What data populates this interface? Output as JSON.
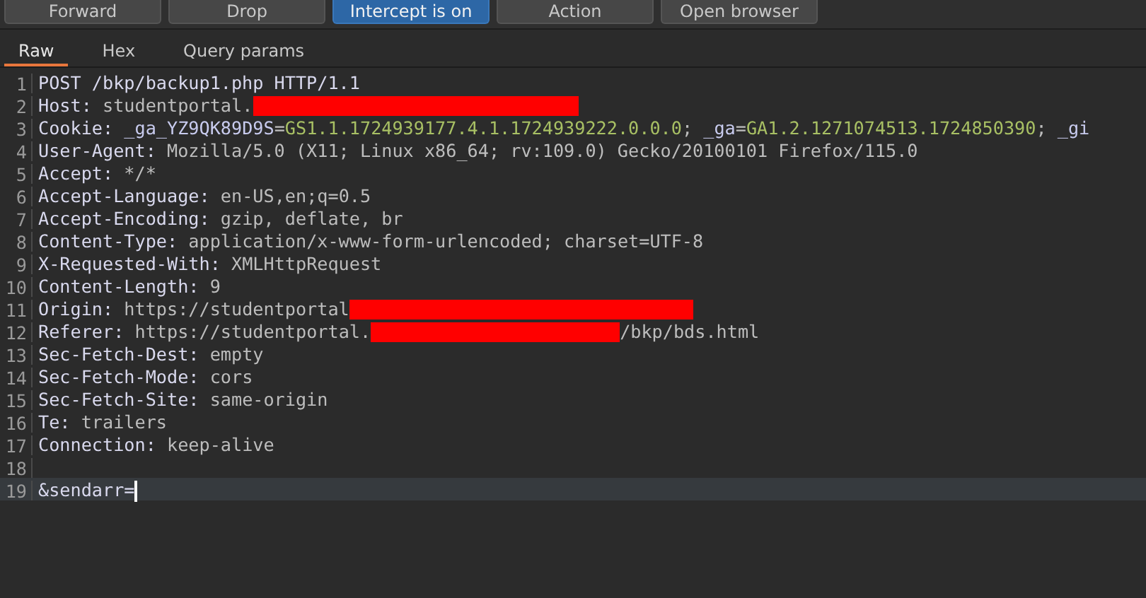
{
  "toolbar": {
    "buttons": [
      {
        "label": "Forward",
        "on": false
      },
      {
        "label": "Drop",
        "on": false
      },
      {
        "label": "Intercept is on",
        "on": true
      },
      {
        "label": "Action",
        "on": false
      },
      {
        "label": "Open browser",
        "on": false
      }
    ]
  },
  "tabs": [
    {
      "label": "Raw",
      "selected": true
    },
    {
      "label": "Hex",
      "selected": false
    },
    {
      "label": "Query params",
      "selected": false
    }
  ],
  "editor": {
    "lines": [
      {
        "number": "1",
        "current": false,
        "segments": [
          {
            "kind": "header",
            "text": "POST /bkp/backup1.php HTTP/1.1"
          }
        ]
      },
      {
        "number": "2",
        "current": false,
        "segments": [
          {
            "kind": "header",
            "text": "Host:"
          },
          {
            "kind": "value",
            "text": " studentportal."
          },
          {
            "kind": "redacted"
          }
        ]
      },
      {
        "number": "3",
        "current": false,
        "segments": [
          {
            "kind": "header",
            "text": "Cookie:"
          },
          {
            "kind": "cookie-key",
            "text": " _ga_YZ9QK89D9S"
          },
          {
            "kind": "value",
            "text": "="
          },
          {
            "kind": "cookie-value",
            "text": "GS1.1.1724939177.4.1.1724939222.0.0.0"
          },
          {
            "kind": "value",
            "text": "; "
          },
          {
            "kind": "cookie-key",
            "text": "_ga"
          },
          {
            "kind": "value",
            "text": "="
          },
          {
            "kind": "cookie-value",
            "text": "GA1.2.1271074513.1724850390"
          },
          {
            "kind": "value",
            "text": "; "
          },
          {
            "kind": "cookie-key",
            "text": "_gi"
          }
        ]
      },
      {
        "number": "4",
        "current": false,
        "segments": [
          {
            "kind": "header",
            "text": "User-Agent:"
          },
          {
            "kind": "value",
            "text": " Mozilla/5.0 (X11; Linux x86_64; rv:109.0) Gecko/20100101 Firefox/115.0"
          }
        ]
      },
      {
        "number": "5",
        "current": false,
        "segments": [
          {
            "kind": "header",
            "text": "Accept:"
          },
          {
            "kind": "value",
            "text": " */*"
          }
        ]
      },
      {
        "number": "6",
        "current": false,
        "segments": [
          {
            "kind": "header",
            "text": "Accept-Language:"
          },
          {
            "kind": "value",
            "text": " en-US,en;q=0.5"
          }
        ]
      },
      {
        "number": "7",
        "current": false,
        "segments": [
          {
            "kind": "header",
            "text": "Accept-Encoding:"
          },
          {
            "kind": "value",
            "text": " gzip, deflate, br"
          }
        ]
      },
      {
        "number": "8",
        "current": false,
        "segments": [
          {
            "kind": "header",
            "text": "Content-Type:"
          },
          {
            "kind": "value",
            "text": " application/x-www-form-urlencoded; charset=UTF-8"
          }
        ]
      },
      {
        "number": "9",
        "current": false,
        "segments": [
          {
            "kind": "header",
            "text": "X-Requested-With:"
          },
          {
            "kind": "value",
            "text": " XMLHttpRequest"
          }
        ]
      },
      {
        "number": "10",
        "current": false,
        "segments": [
          {
            "kind": "header",
            "text": "Content-Length:"
          },
          {
            "kind": "value",
            "text": " 9"
          }
        ]
      },
      {
        "number": "11",
        "current": false,
        "segments": [
          {
            "kind": "header",
            "text": "Origin:"
          },
          {
            "kind": "value",
            "text": " https://studentportal"
          },
          {
            "kind": "redacted"
          }
        ]
      },
      {
        "number": "12",
        "current": false,
        "segments": [
          {
            "kind": "header",
            "text": "Referer:"
          },
          {
            "kind": "value",
            "text": " https://studentportal."
          },
          {
            "kind": "redacted"
          },
          {
            "kind": "value",
            "text": "/bkp/bds.html"
          }
        ]
      },
      {
        "number": "13",
        "current": false,
        "segments": [
          {
            "kind": "header",
            "text": "Sec-Fetch-Dest:"
          },
          {
            "kind": "value",
            "text": " empty"
          }
        ]
      },
      {
        "number": "14",
        "current": false,
        "segments": [
          {
            "kind": "header",
            "text": "Sec-Fetch-Mode:"
          },
          {
            "kind": "value",
            "text": " cors"
          }
        ]
      },
      {
        "number": "15",
        "current": false,
        "segments": [
          {
            "kind": "header",
            "text": "Sec-Fetch-Site:"
          },
          {
            "kind": "value",
            "text": " same-origin"
          }
        ]
      },
      {
        "number": "16",
        "current": false,
        "segments": [
          {
            "kind": "header",
            "text": "Te:"
          },
          {
            "kind": "value",
            "text": " trailers"
          }
        ]
      },
      {
        "number": "17",
        "current": false,
        "segments": [
          {
            "kind": "header",
            "text": "Connection:"
          },
          {
            "kind": "value",
            "text": " keep-alive"
          }
        ]
      },
      {
        "number": "18",
        "current": false
      },
      {
        "number": "19",
        "current": true,
        "segments": [
          {
            "kind": "header",
            "text": "&sendarr="
          }
        ]
      }
    ]
  }
}
